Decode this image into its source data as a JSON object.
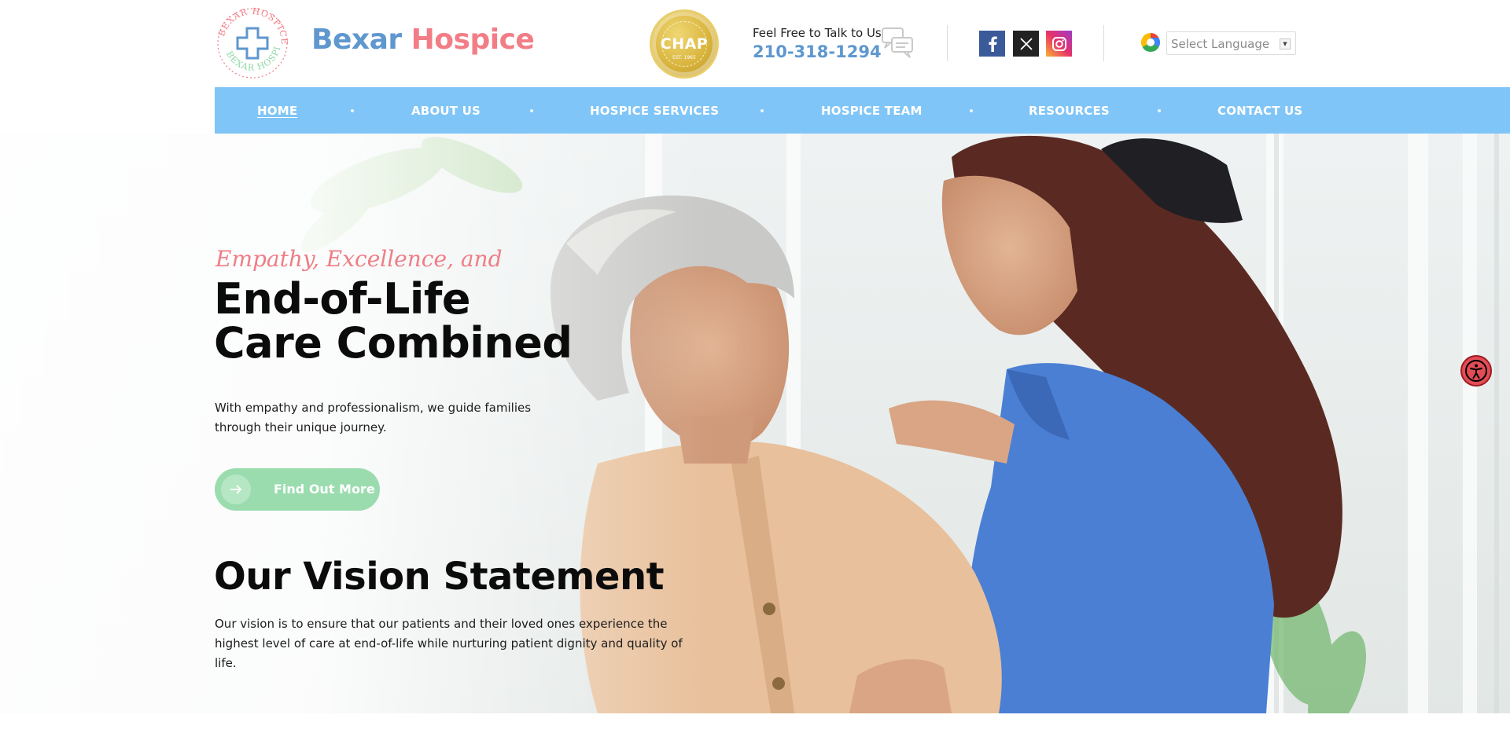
{
  "header": {
    "brand_part1": "Bexar",
    "brand_part2": "Hospice",
    "seal_text": "BEXAR HOSPICE",
    "chap_badge": "CHAP",
    "chap_est": "EST. 1965",
    "contact_label": "Feel Free to Talk to Us",
    "phone": "210-318-1294",
    "social": [
      "facebook-icon",
      "x-twitter-icon",
      "instagram-icon"
    ],
    "language_select": "Select Language"
  },
  "nav": {
    "items": [
      {
        "label": "HOME",
        "active": true
      },
      {
        "label": "ABOUT US"
      },
      {
        "label": "HOSPICE SERVICES"
      },
      {
        "label": "HOSPICE TEAM"
      },
      {
        "label": "RESOURCES"
      },
      {
        "label": "CONTACT US"
      }
    ]
  },
  "hero": {
    "tagline": "Empathy, Excellence, and",
    "headline_line1": "End-of-Life",
    "headline_line2": "Care Combined",
    "intro": "With empathy and professionalism, we guide families through their unique journey.",
    "cta_label": "Find Out More",
    "vision_title": "Our Vision Statement",
    "vision_body": "Our vision is to ensure that our patients and their loved ones experience the highest level of care at end-of-life while nurturing patient dignity and quality of life."
  },
  "colors": {
    "brand_blue": "#5f97cf",
    "brand_pink": "#f27d86",
    "nav_bg": "#80c5f7",
    "cta_green": "#9bdcaf",
    "accessibility_red": "#e24d55"
  }
}
